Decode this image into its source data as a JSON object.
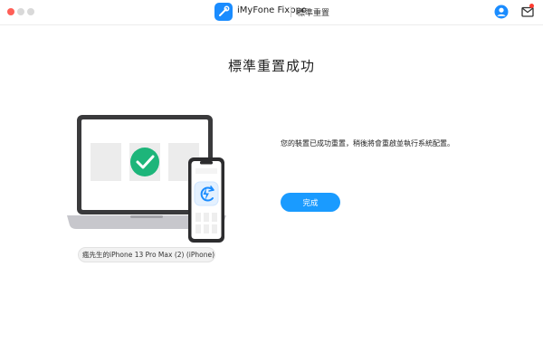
{
  "titlebar": {
    "app_name": "iMyFone Fixppo",
    "mode_name": "標準重置",
    "icons": [
      "app-logo",
      "user-icon",
      "mail-icon"
    ],
    "colors": {
      "close": "#ff5f57",
      "inactive": "#d9d9d9",
      "accent": "#1a9bff",
      "badge": "#ff3b30"
    }
  },
  "main": {
    "title": "標準重置成功",
    "message": "您的裝置已成功重置，稍後將會重啟並執行系統配置。",
    "done_label": "完成"
  },
  "device": {
    "name": "瘋先生的iPhone 13 Pro Max (2) (iPhone)",
    "icon": "phone-icon"
  },
  "illustration": {
    "icons": [
      "laptop",
      "check-circle-icon",
      "phone",
      "refresh-lightning-icon"
    ],
    "colors": {
      "check": "#1db57a",
      "refresh": "#1a8cff"
    }
  }
}
